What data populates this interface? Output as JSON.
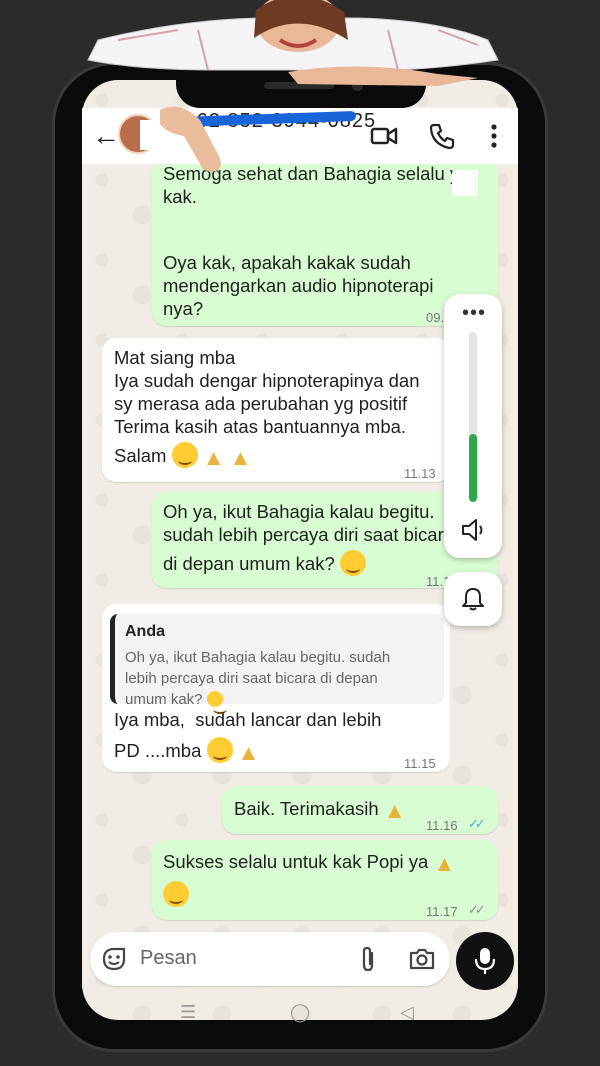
{
  "header": {
    "contact_name": "+62 852-3944-0825",
    "back_icon": "arrow-left-icon",
    "video_icon": "video-camera-icon",
    "call_icon": "phone-icon",
    "menu_icon": "more-vertical-icon"
  },
  "messages": [
    {
      "direction": "out",
      "lines": [
        "Semoga sehat dan Bahagia selalu ya",
        "kak.",
        "",
        "Oya kak, apakah kakak sudah",
        "mendengarkan audio hipnoterapi",
        "nya?"
      ],
      "time": "09.__"
    },
    {
      "direction": "in",
      "lines": [
        "Mat siang mba",
        "Iya sudah dengar hipnoterapinya dan",
        "sy merasa ada perubahan yg positif",
        "Terima kasih atas bantuannya mba.",
        "Salam"
      ],
      "time": "11.13"
    },
    {
      "direction": "out",
      "lines": [
        "Oh ya, ikut Bahagia kalau begitu.",
        "sudah lebih percaya diri saat bicara",
        "di depan umum kak?"
      ],
      "time": "11.1_"
    },
    {
      "direction": "in",
      "quote": {
        "name": "Anda",
        "text": [
          "Oh ya, ikut Bahagia kalau begitu. sudah",
          "lebih percaya diri saat bicara di depan",
          "umum kak?"
        ]
      },
      "lines": [
        "Iya mba,  sudah lancar dan lebih",
        "PD ....mba"
      ],
      "time": "11.15"
    },
    {
      "direction": "out",
      "lines": [
        "Baik. Terimakasih"
      ],
      "time": "11.16"
    },
    {
      "direction": "out",
      "lines": [
        "Sukses selalu untuk kak Popi ya"
      ],
      "time": "11.17"
    }
  ],
  "input": {
    "placeholder": "Pesan",
    "sticker_icon": "sticker-icon",
    "attach_icon": "paperclip-icon",
    "camera_icon": "camera-icon",
    "mic_icon": "microphone-icon"
  },
  "volume_panel": {
    "level_percent": 40,
    "more_icon": "more-horizontal-icon",
    "speaker_icon": "speaker-icon",
    "bell_icon": "bell-icon"
  },
  "colors": {
    "outgoing_bubble": "#d9fdd3",
    "incoming_bubble": "#ffffff",
    "read_ticks": "#4da4e8",
    "volume_fill": "#2ea84a"
  }
}
